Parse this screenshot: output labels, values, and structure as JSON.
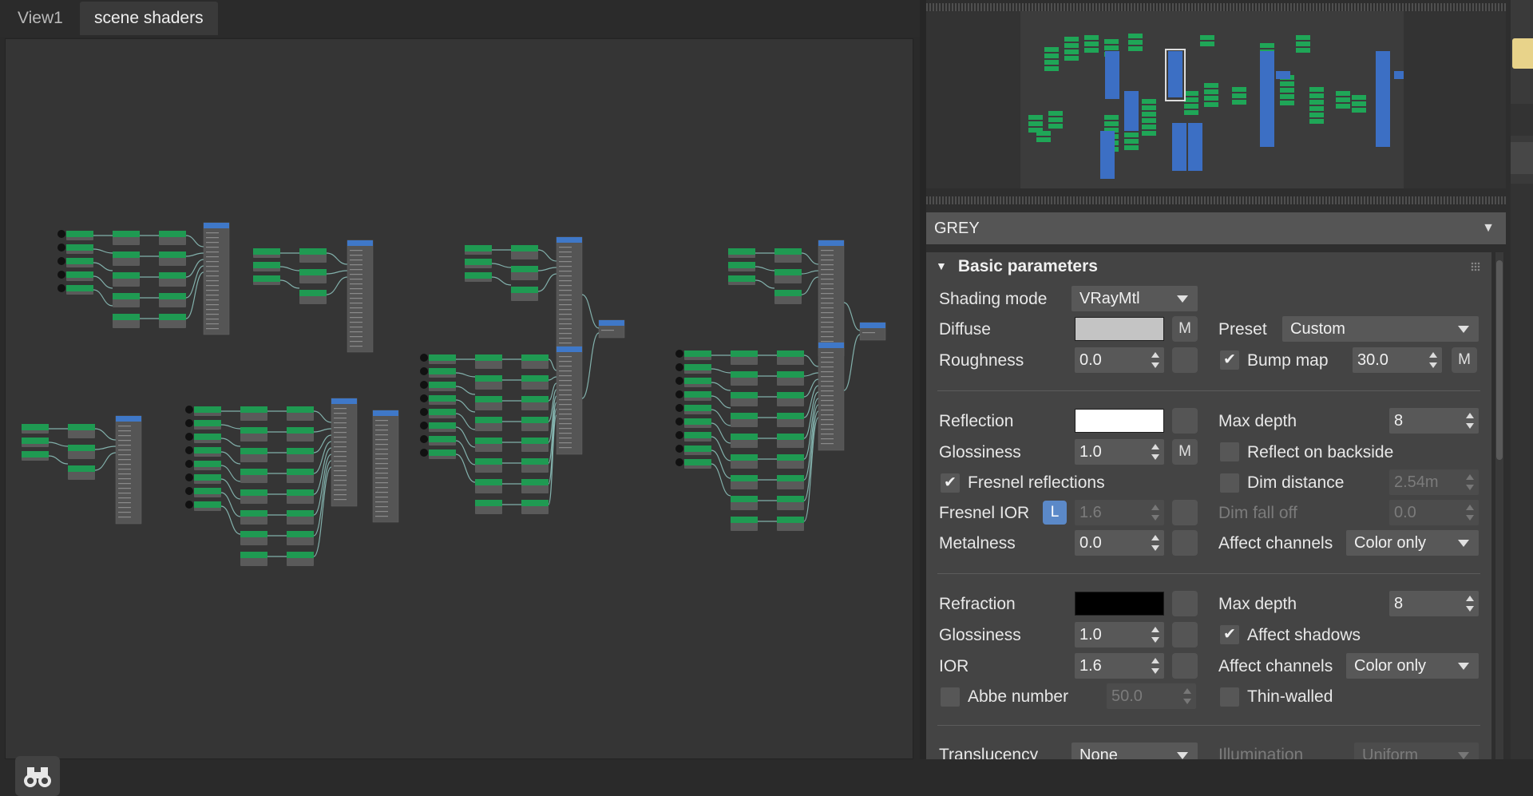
{
  "tabs": [
    {
      "label": "View1",
      "active": false
    },
    {
      "label": "scene shaders",
      "active": true
    }
  ],
  "material_selector": {
    "value": "GREY"
  },
  "rollout": {
    "title": "Basic parameters"
  },
  "params": {
    "shading_mode_label": "Shading mode",
    "shading_mode_value": "VRayMtl",
    "diffuse_label": "Diffuse",
    "diffuse_color": "#c4c4c4",
    "map_label": "M",
    "preset_label": "Preset",
    "preset_value": "Custom",
    "roughness_label": "Roughness",
    "roughness_value": "0.0",
    "bump_label": "Bump map",
    "bump_value": "30.0",
    "reflection_label": "Reflection",
    "reflection_color": "#ffffff",
    "refl_max_depth_label": "Max depth",
    "refl_max_depth_value": "8",
    "refl_gloss_label": "Glossiness",
    "refl_gloss_value": "1.0",
    "reflect_backside_label": "Reflect on backside",
    "fresnel_label": "Fresnel reflections",
    "dim_distance_label": "Dim distance",
    "dim_distance_value": "2.54m",
    "fresnel_ior_label": "Fresnel IOR",
    "lock_label": "L",
    "fresnel_ior_value": "1.6",
    "dim_falloff_label": "Dim fall off",
    "dim_falloff_value": "0.0",
    "metalness_label": "Metalness",
    "metalness_value": "0.0",
    "affect_channels_label": "Affect channels",
    "affect_channels_value": "Color only",
    "refraction_label": "Refraction",
    "refraction_color": "#000000",
    "refr_max_depth_label": "Max depth",
    "refr_max_depth_value": "8",
    "refr_gloss_label": "Glossiness",
    "refr_gloss_value": "1.0",
    "affect_shadows_label": "Affect shadows",
    "ior_label": "IOR",
    "ior_value": "1.6",
    "refr_affect_channels_label": "Affect channels",
    "refr_affect_channels_value": "Color only",
    "abbe_label": "Abbe number",
    "abbe_value": "50.0",
    "thin_walled_label": "Thin-walled",
    "translucency_label": "Translucency",
    "translucency_value": "None",
    "illumination_label": "Illumination",
    "illumination_value": "Uniform"
  },
  "colors": {
    "node_green": "#1f9a52",
    "node_blue": "#3f78c8",
    "node_body": "#5a5a5a",
    "wire": "#8fc6c0",
    "nav_green": "#1fa657",
    "nav_blue": "#3c6fc4"
  },
  "icons": {
    "search": "binoculars-icon",
    "rollout_toggle": "triangle-down-icon",
    "dropdown": "chevron-down-icon"
  }
}
